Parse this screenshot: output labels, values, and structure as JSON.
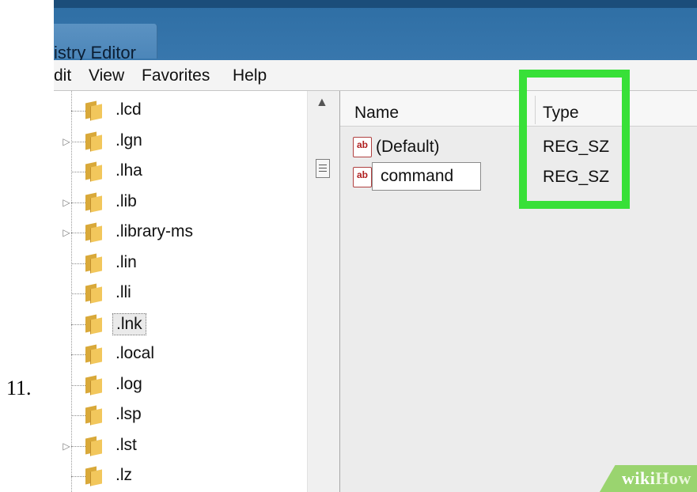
{
  "step_number": "11.",
  "window": {
    "title": "istry Editor"
  },
  "menu": [
    "dit",
    "View",
    "Favorites",
    "Help"
  ],
  "tree": {
    "items": [
      {
        "label": ".lcd",
        "expandable": false
      },
      {
        "label": ".lgn",
        "expandable": true
      },
      {
        "label": ".lha",
        "expandable": false
      },
      {
        "label": ".lib",
        "expandable": true
      },
      {
        "label": ".library-ms",
        "expandable": true
      },
      {
        "label": ".lin",
        "expandable": false
      },
      {
        "label": ".lli",
        "expandable": false
      },
      {
        "label": ".lnk",
        "expandable": false,
        "selected": true
      },
      {
        "label": ".local",
        "expandable": false
      },
      {
        "label": ".log",
        "expandable": false
      },
      {
        "label": ".lsp",
        "expandable": false
      },
      {
        "label": ".lst",
        "expandable": true
      },
      {
        "label": ".lz",
        "expandable": false
      }
    ]
  },
  "values_table": {
    "columns": {
      "name": "Name",
      "type": "Type"
    },
    "rows": [
      {
        "name": "(Default)",
        "type": "REG_SZ",
        "icon": "reg-sz-icon",
        "editing": false
      },
      {
        "name": "command",
        "type": "REG_SZ",
        "icon": "reg-sz-icon",
        "editing": true
      }
    ],
    "icon_text": "ab"
  },
  "highlight_color": "#38e038",
  "watermark": {
    "part1": "wiki",
    "part2": "How"
  }
}
